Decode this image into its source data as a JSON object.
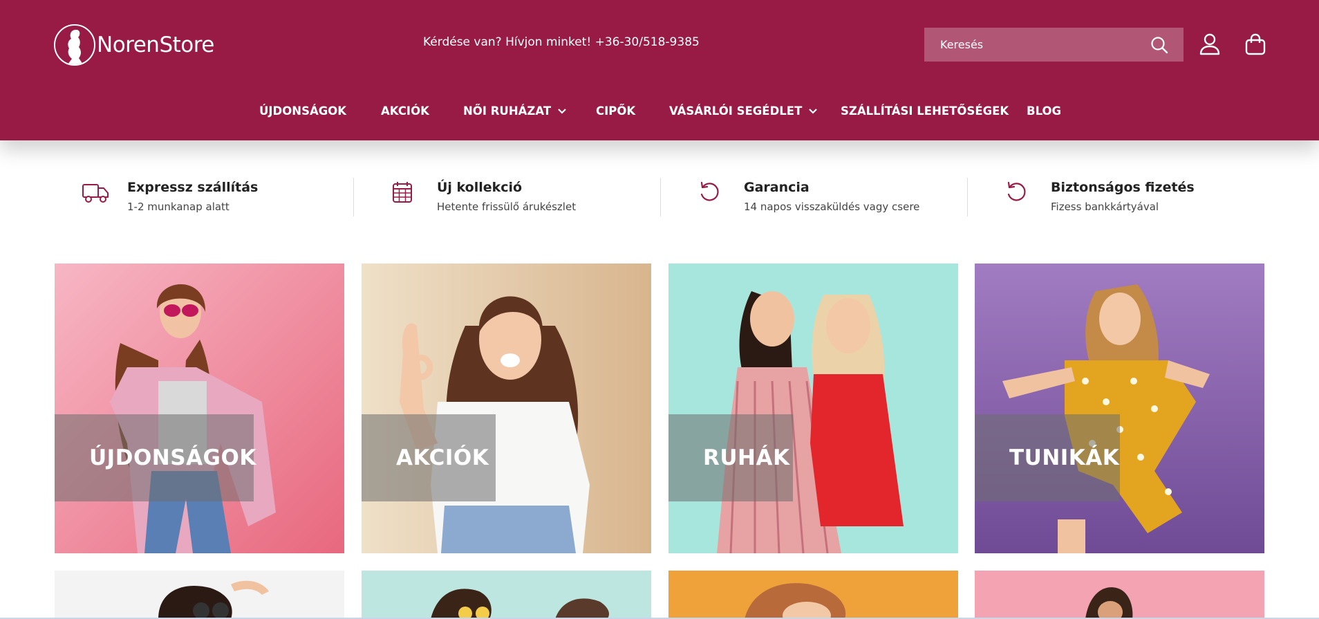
{
  "header": {
    "logo_text": "NorenStore",
    "contact_text": "Kérdése van? Hívjon minket! +36-30/518-9385",
    "search_placeholder": "Keresés",
    "icons": [
      "search-icon",
      "user-icon",
      "shopping-bag-icon"
    ],
    "brand_color": "#981b45"
  },
  "nav": {
    "items": [
      {
        "label": "ÚJDONSÁGOK",
        "dropdown": false
      },
      {
        "label": "AKCIÓK",
        "dropdown": false
      },
      {
        "label": "NŐI RUHÁZAT",
        "dropdown": true
      },
      {
        "label": "CIPŐK",
        "dropdown": false
      },
      {
        "label": "VÁSÁRLÓI SEGÉDLET",
        "dropdown": true
      },
      {
        "label": "SZÁLLÍTÁSI LEHETŐSÉGEK",
        "dropdown": false
      },
      {
        "label": "BLOG",
        "dropdown": false
      }
    ]
  },
  "features": [
    {
      "icon": "truck-icon",
      "title": "Expressz szállítás",
      "subtitle": "1-2 munkanap alatt"
    },
    {
      "icon": "calendar-icon",
      "title": "Új kollekció",
      "subtitle": "Hetente frissülő árukészlet"
    },
    {
      "icon": "return-icon",
      "title": "Garancia",
      "subtitle": "14 napos visszaküldés vagy csere"
    },
    {
      "icon": "return-icon",
      "title": "Biztonságos fizetés",
      "subtitle": "Fizess bankkártyával"
    }
  ],
  "categories": [
    {
      "label": "ÚJDONSÁGOK",
      "bg": "#f08a9c"
    },
    {
      "label": "AKCIÓK",
      "bg": "#e9d2b3"
    },
    {
      "label": "RUHÁK",
      "bg": "#9fe3da"
    },
    {
      "label": "TUNIKÁK",
      "bg": "#8a62ad"
    }
  ]
}
